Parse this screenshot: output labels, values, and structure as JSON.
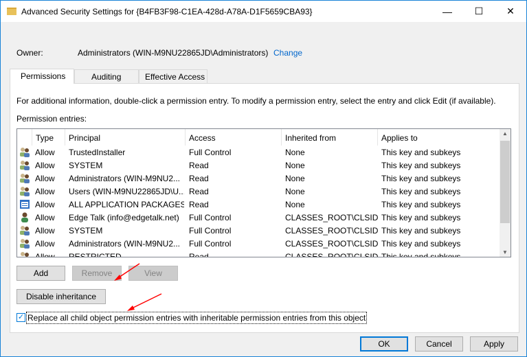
{
  "window": {
    "title": "Advanced Security Settings for {B4FB3F98-C1EA-428d-A78A-D1F5659CBA93}"
  },
  "owner": {
    "label": "Owner:",
    "value": "Administrators (WIN-M9NU22865JD\\Administrators)",
    "change_link": "Change"
  },
  "tabs": [
    {
      "label": "Permissions"
    },
    {
      "label": "Auditing"
    },
    {
      "label": "Effective Access"
    }
  ],
  "info_text": "For additional information, double-click a permission entry. To modify a permission entry, select the entry and click Edit (if available).",
  "entries_label": "Permission entries:",
  "columns": [
    "Type",
    "Principal",
    "Access",
    "Inherited from",
    "Applies to"
  ],
  "rows": [
    {
      "icon": "group",
      "type": "Allow",
      "principal": "TrustedInstaller",
      "access": "Full Control",
      "inherited": "None",
      "applies": "This key and subkeys"
    },
    {
      "icon": "group",
      "type": "Allow",
      "principal": "SYSTEM",
      "access": "Read",
      "inherited": "None",
      "applies": "This key and subkeys"
    },
    {
      "icon": "group",
      "type": "Allow",
      "principal": "Administrators (WIN-M9NU2...",
      "access": "Read",
      "inherited": "None",
      "applies": "This key and subkeys"
    },
    {
      "icon": "group",
      "type": "Allow",
      "principal": "Users (WIN-M9NU22865JD\\U...",
      "access": "Read",
      "inherited": "None",
      "applies": "This key and subkeys"
    },
    {
      "icon": "app-packages",
      "type": "Allow",
      "principal": "ALL APPLICATION PACKAGES",
      "access": "Read",
      "inherited": "None",
      "applies": "This key and subkeys"
    },
    {
      "icon": "user",
      "type": "Allow",
      "principal": "Edge Talk (info@edgetalk.net)",
      "access": "Full Control",
      "inherited": "CLASSES_ROOT\\CLSID",
      "applies": "This key and subkeys"
    },
    {
      "icon": "group",
      "type": "Allow",
      "principal": "SYSTEM",
      "access": "Full Control",
      "inherited": "CLASSES_ROOT\\CLSID",
      "applies": "This key and subkeys"
    },
    {
      "icon": "group",
      "type": "Allow",
      "principal": "Administrators (WIN-M9NU2...",
      "access": "Full Control",
      "inherited": "CLASSES_ROOT\\CLSID",
      "applies": "This key and subkeys"
    },
    {
      "icon": "group",
      "type": "Allow",
      "principal": "RESTRICTED",
      "access": "Read",
      "inherited": "CLASSES_ROOT\\CLSID",
      "applies": "This key and subkeys"
    }
  ],
  "buttons": {
    "add": "Add",
    "remove": "Remove",
    "view": "View",
    "disable_inheritance": "Disable inheritance",
    "ok": "OK",
    "cancel": "Cancel",
    "apply": "Apply"
  },
  "replace_checkbox": {
    "label": "Replace all child object permission entries with inheritable permission entries from this object",
    "checked": true
  },
  "colors": {
    "accent": "#0078d7",
    "arrow": "#ff0000"
  }
}
